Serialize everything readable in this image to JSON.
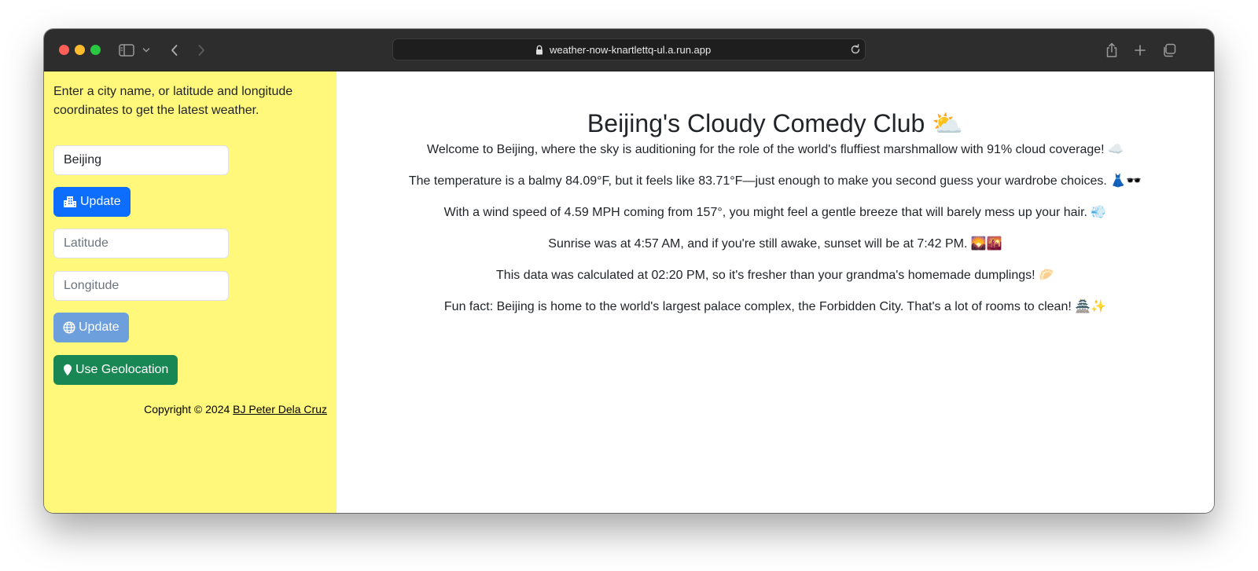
{
  "browser": {
    "url": "weather-now-knartlettq-ul.a.run.app"
  },
  "sidebar": {
    "intro": "Enter a city name, or latitude and longitude coordinates to get the latest weather.",
    "city_value": "Beijing",
    "update_city_label": "Update",
    "latitude_placeholder": "Latitude",
    "longitude_placeholder": "Longitude",
    "update_coords_label": "Update",
    "geolocation_label": "Use Geolocation",
    "copyright_prefix": "Copyright © 2024 ",
    "copyright_author": "BJ Peter Dela Cruz"
  },
  "main": {
    "title": "Beijing's Cloudy Comedy Club ⛅",
    "paragraphs": [
      "Welcome to Beijing, where the sky is auditioning for the role of the world's fluffiest marshmallow with 91% cloud coverage! ☁️",
      "The temperature is a balmy 84.09°F, but it feels like 83.71°F—just enough to make you second guess your wardrobe choices. 👗🕶️",
      "With a wind speed of 4.59 MPH coming from 157°, you might feel a gentle breeze that will barely mess up your hair. 💨",
      "Sunrise was at 4:57 AM, and if you're still awake, sunset will be at 7:42 PM. 🌄🌇",
      "This data was calculated at 02:20 PM, so it's fresher than your grandma's homemade dumplings! 🥟",
      "Fun fact: Beijing is home to the world's largest palace complex, the Forbidden City. That's a lot of rooms to clean! 🏯✨"
    ]
  },
  "colors": {
    "sidebar_bg": "#fff87a",
    "primary": "#0d6efd",
    "primary_disabled": "#6c9fdc",
    "success": "#198754",
    "toolbar_bg": "#2d2d2d"
  },
  "icons": {
    "update_city": "city-icon",
    "update_coords": "globe-icon",
    "geolocation": "map-pin-icon"
  }
}
